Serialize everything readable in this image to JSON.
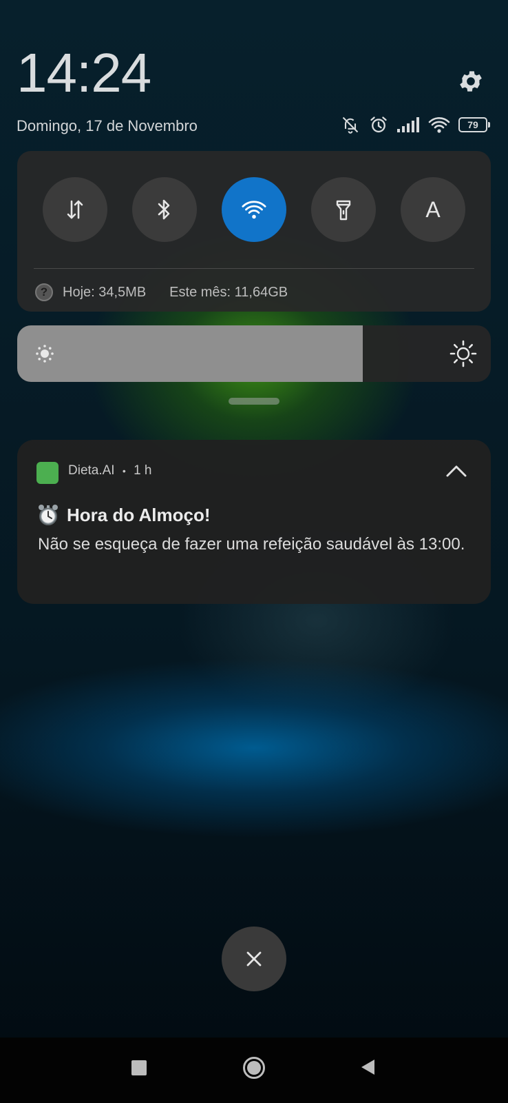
{
  "status": {
    "time": "14:24",
    "date": "Domingo, 17 de Novembro",
    "battery": "79",
    "icons": [
      "notifications-muted-icon",
      "alarm-icon",
      "signal-icon",
      "wifi-icon",
      "battery-icon"
    ]
  },
  "quick_settings": {
    "toggles": [
      {
        "name": "mobile-data",
        "icon": "data-arrows-icon",
        "active": false
      },
      {
        "name": "bluetooth",
        "icon": "bluetooth-icon",
        "active": false
      },
      {
        "name": "wifi",
        "icon": "wifi-icon",
        "active": true
      },
      {
        "name": "flashlight",
        "icon": "flashlight-icon",
        "active": false
      },
      {
        "name": "auto-brightness",
        "icon": "letter-a-icon",
        "label": "A",
        "active": false
      }
    ],
    "data_usage": {
      "today": "Hoje: 34,5MB",
      "month": "Este mês: 11,64GB"
    },
    "brightness_level": 0.73
  },
  "notification": {
    "app_name": "Dieta.AI",
    "separator": "•",
    "time_ago": "1 h",
    "title": "Hora do Almoço!",
    "title_emoji": "alarm-clock-icon",
    "body": "Não se esqueça de fazer uma refeição saudável às 13:00."
  },
  "colors": {
    "accent": "#1174c9",
    "app_icon": "#4caf50"
  },
  "navigation": [
    "recents-button",
    "home-button",
    "back-button"
  ]
}
